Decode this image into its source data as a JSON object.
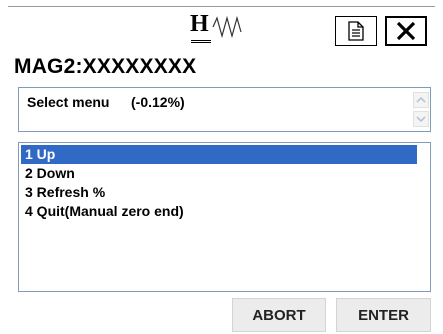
{
  "logo": {
    "letter": "H",
    "icon": "hw-logo-wave"
  },
  "toolbar": {
    "document_icon": "document-icon",
    "close_icon": "close-icon"
  },
  "device_title": "MAG2:XXXXXXXX",
  "header": {
    "label": "Select menu",
    "value": "(-0.12%)"
  },
  "menu": {
    "items": [
      {
        "label": "1 Up",
        "selected": true
      },
      {
        "label": "2 Down",
        "selected": false
      },
      {
        "label": "3 Refresh %",
        "selected": false
      },
      {
        "label": "4 Quit(Manual zero end)",
        "selected": false
      }
    ]
  },
  "buttons": {
    "abort": "ABORT",
    "enter": "ENTER"
  },
  "colors": {
    "selection": "#316ac5",
    "border": "#7f9db9",
    "button_bg": "#ececec"
  }
}
